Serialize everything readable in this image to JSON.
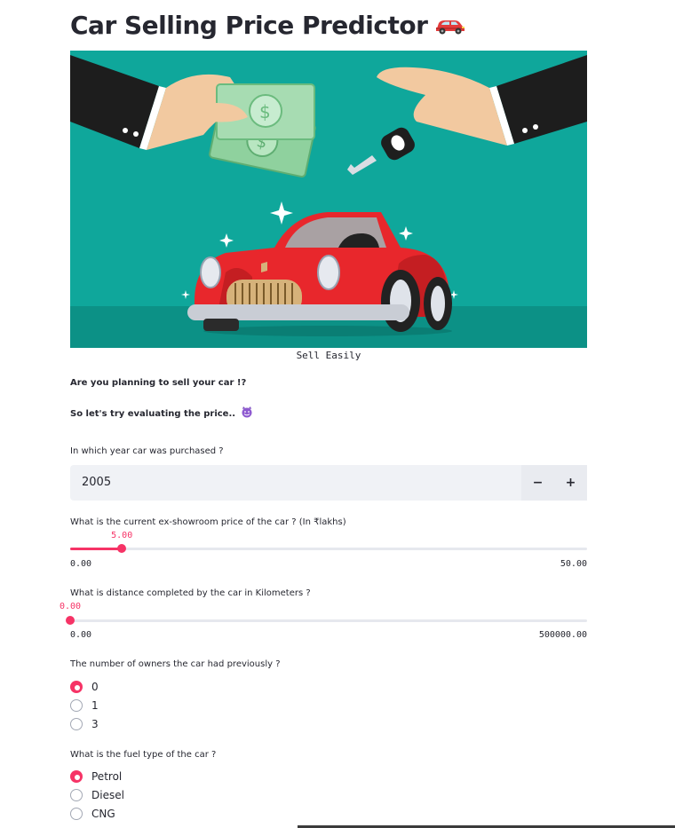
{
  "app": {
    "title": "Car Selling Price Predictor"
  },
  "hero": {
    "caption": "Sell Easily"
  },
  "intro": {
    "line1": "Are you planning to sell your car !?",
    "line2": "So let's try evaluating the price.."
  },
  "year_input": {
    "label": "In which year car was purchased ?",
    "value": "2005",
    "minus_label": "−",
    "plus_label": "+"
  },
  "price_slider": {
    "label": "What is the current ex-showroom price of the car ? (In ₹lakhs)",
    "value_text": "5.00",
    "min_text": "0.00",
    "max_text": "50.00",
    "fraction": 0.1
  },
  "km_slider": {
    "label": "What is distance completed by the car in Kilometers ?",
    "value_text": "0.00",
    "min_text": "0.00",
    "max_text": "500000.00",
    "fraction": 0.0
  },
  "owners": {
    "label": "The number of owners the car had previously ?",
    "options": [
      "0",
      "1",
      "3"
    ],
    "selected": "0"
  },
  "fuel": {
    "label": "What is the fuel type of the car ?",
    "options": [
      "Petrol",
      "Diesel",
      "CNG"
    ],
    "selected": "Petrol"
  },
  "colors": {
    "accent": "#f63366",
    "hero_bg": "#0fa79b",
    "car_red": "#e8272c"
  }
}
